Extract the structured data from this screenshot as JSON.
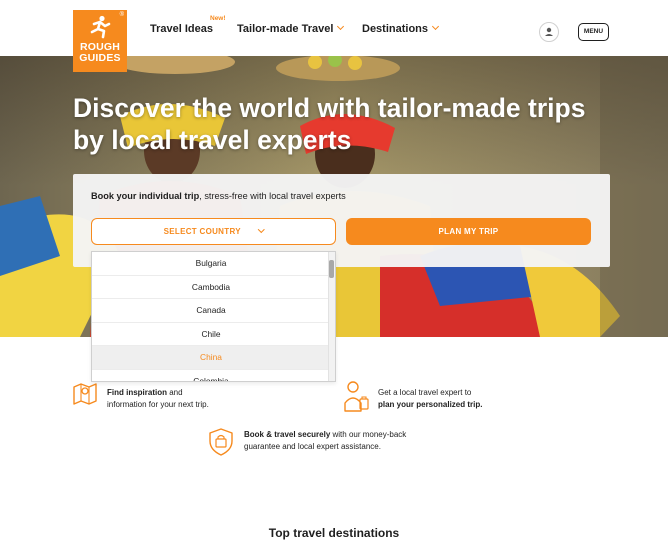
{
  "header": {
    "logo_line1": "ROUGH",
    "logo_line2": "GUIDES",
    "logo_mark": "®",
    "nav": [
      {
        "label": "Travel Ideas",
        "badge": "New!"
      },
      {
        "label": "Tailor-made Travel"
      },
      {
        "label": "Destinations"
      }
    ],
    "user_icon": "user-icon",
    "menu_label": "MENU"
  },
  "hero": {
    "title": "Discover the world with tailor-made trips by local travel experts"
  },
  "booking": {
    "text_bold": "Book your individual trip",
    "text_rest": ", stress-free with local travel experts",
    "select_label": "SELECT COUNTRY",
    "plan_label": "PLAN MY TRIP"
  },
  "dropdown": {
    "options": [
      "Bulgaria",
      "Cambodia",
      "Canada",
      "Chile",
      "China",
      "Colombia"
    ],
    "highlighted": "China"
  },
  "features": [
    {
      "bold": "Find inspiration",
      "text1": " and",
      "text2": "information for your next trip.",
      "icon": "map-icon"
    },
    {
      "pre": "Get a local travel expert to",
      "bold": "plan your personalized trip.",
      "icon": "travel-expert-icon"
    },
    {
      "bold": "Book & travel securely",
      "text1": " with our money-back",
      "text2": "guarantee and local expert assistance.",
      "icon": "shield-icon"
    }
  ],
  "section_title": "Top travel destinations",
  "colors": {
    "accent": "#f68a1e",
    "text": "#1f1f1f"
  }
}
